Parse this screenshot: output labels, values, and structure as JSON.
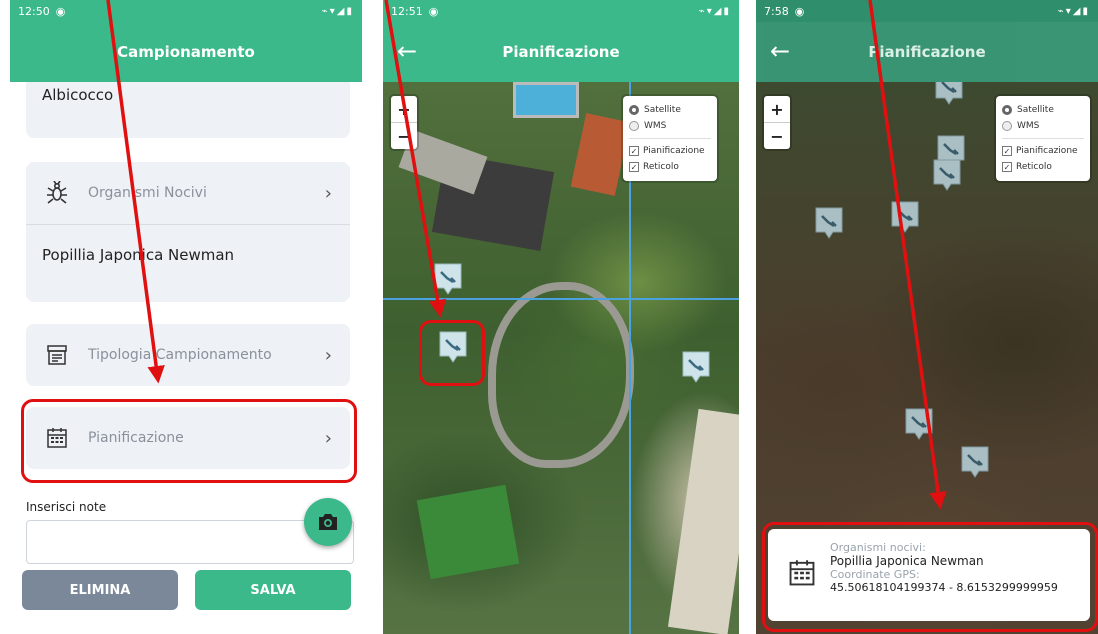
{
  "screen1": {
    "time": "12:50",
    "title": "Campionamento",
    "top_value": "Albicocco",
    "organismi": {
      "label": "Organismi Nocivi",
      "value": "Popillia Japonica Newman"
    },
    "tipologia_label": "Tipologia Campionamento",
    "pianificazione_label": "Pianificazione",
    "note_label": "Inserisci note",
    "note_value": "",
    "elimina_label": "ELIMINA",
    "salva_label": "SALVA"
  },
  "screen2": {
    "time": "12:51",
    "title": "Pianificazione",
    "zoom_in": "+",
    "zoom_out": "−",
    "layers": {
      "satellite": "Satellite",
      "wms": "WMS",
      "pianificazione": "Pianificazione",
      "reticolo": "Reticolo"
    }
  },
  "screen3": {
    "time": "7:58",
    "title": "Pianificazione",
    "zoom_in": "+",
    "zoom_out": "−",
    "layers": {
      "satellite": "Satellite",
      "wms": "WMS",
      "pianificazione": "Pianificazione",
      "reticolo": "Reticolo"
    },
    "popup": {
      "organismi_label": "Organismi nocivi:",
      "organismi_value": "Popillia Japonica Newman",
      "gps_label": "Coordinate GPS:",
      "gps_value": "45.50618104199374 - 8.6153299999959"
    }
  },
  "colors": {
    "primary": "#3cb98a",
    "highlight": "#e01010",
    "grey_button": "#7a8899"
  },
  "icons": [
    "bug-icon",
    "chevron-right-icon",
    "form-icon",
    "calendar-icon",
    "camera-icon",
    "back-arrow-icon",
    "trap-marker-icon"
  ]
}
